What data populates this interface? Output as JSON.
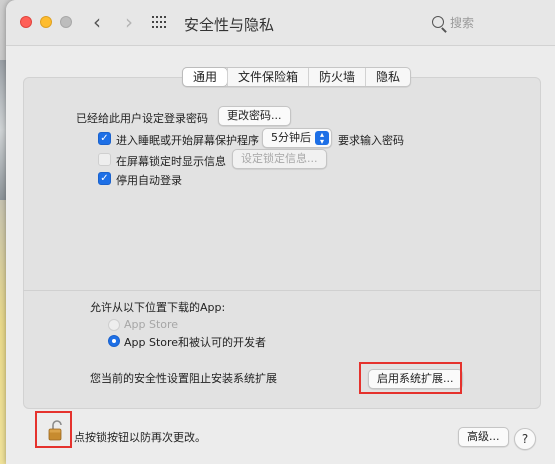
{
  "window": {
    "title": "安全性与隐私",
    "search_placeholder": "搜索",
    "nav_back": "‹",
    "nav_forward": "›"
  },
  "tabs": [
    {
      "label": "通用",
      "active": true
    },
    {
      "label": "文件保险箱",
      "active": false
    },
    {
      "label": "防火墙",
      "active": false
    },
    {
      "label": "隐私",
      "active": false
    }
  ],
  "general": {
    "password_set_label": "已经给此用户设定登录密码",
    "change_password_button": "更改密码...",
    "require_password": {
      "checked": true,
      "label_prefix": "进入睡眠或开始屏幕保护程序",
      "delay_value": "5分钟后",
      "label_suffix": "要求输入密码"
    },
    "show_message": {
      "checked": false,
      "label": "在屏幕锁定时显示信息",
      "button": "设定锁定信息..."
    },
    "disable_auto_login": {
      "checked": true,
      "label": "停用自动登录"
    }
  },
  "downloads": {
    "label": "允许从以下位置下载的App:",
    "options": [
      {
        "label": "App Store",
        "selected": false
      },
      {
        "label": "App Store和被认可的开发者",
        "selected": true
      }
    ]
  },
  "extensions": {
    "blocked_label": "您当前的安全性设置阻止安装系统扩展",
    "enable_button": "启用系统扩展..."
  },
  "footer": {
    "lock_text": "点按锁按钮以防再次更改。",
    "advanced_button": "高级...",
    "help_button": "?"
  },
  "colors": {
    "accent": "#1d6fe6",
    "highlight": "#e5322d"
  }
}
